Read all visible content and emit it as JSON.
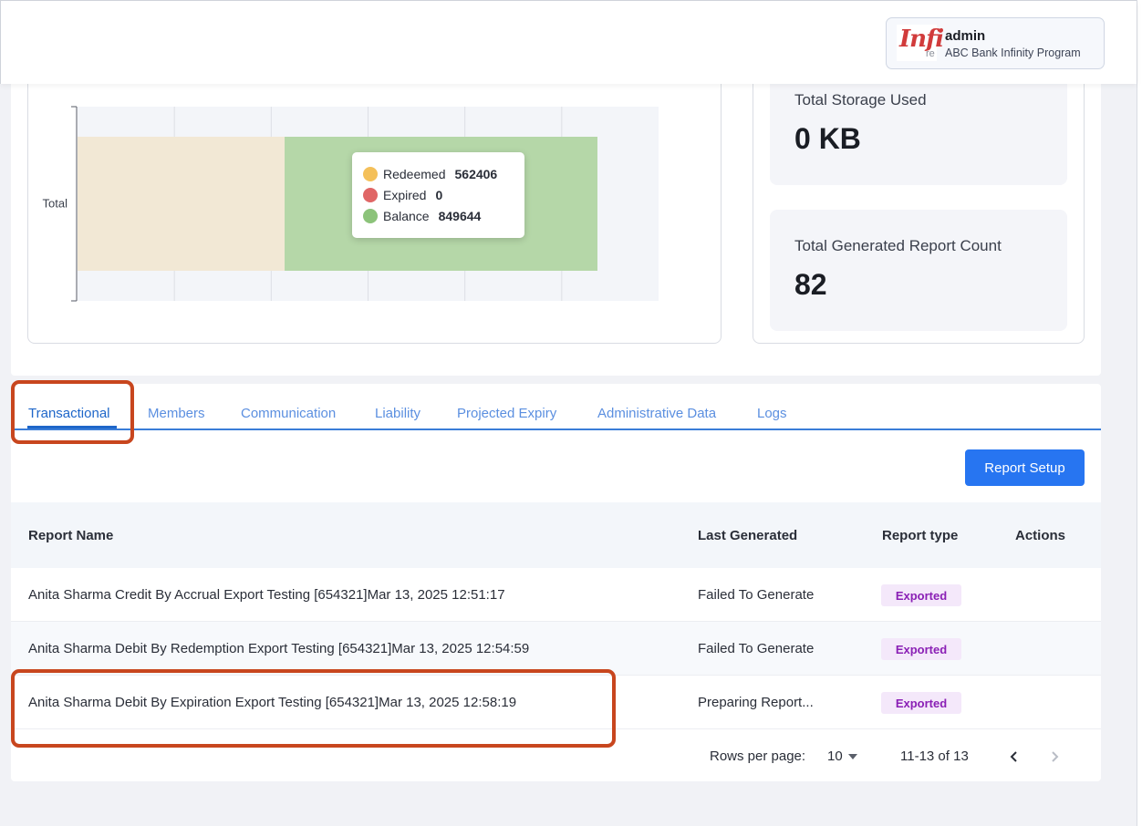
{
  "header": {
    "logo_text": "Infi",
    "logo_sub": "re",
    "user_name": "admin",
    "user_org": "ABC Bank Infinity Program"
  },
  "chart_data": {
    "type": "bar",
    "orientation": "horizontal",
    "stacked": true,
    "categories": [
      "Total"
    ],
    "series": [
      {
        "name": "Redeemed",
        "values": [
          562406
        ],
        "color": "#f2e8d5"
      },
      {
        "name": "Expired",
        "values": [
          0
        ],
        "color": "#e06666"
      },
      {
        "name": "Balance",
        "values": [
          849644
        ],
        "color": "#b5d7a8"
      }
    ],
    "grid": true,
    "legend_position": "tooltip",
    "tooltip": {
      "items": [
        {
          "label": "Redeemed",
          "value": "562406",
          "color": "#f4c05a"
        },
        {
          "label": "Expired",
          "value": "0",
          "color": "#e06666"
        },
        {
          "label": "Balance",
          "value": "849644",
          "color": "#8cc37a"
        }
      ]
    }
  },
  "stats": {
    "storage": {
      "label": "Total Storage Used",
      "value": "0 KB"
    },
    "report_count": {
      "label": "Total Generated Report Count",
      "value": "82"
    }
  },
  "tabs": [
    {
      "label": "Transactional",
      "active": true
    },
    {
      "label": "Members",
      "active": false
    },
    {
      "label": "Communication",
      "active": false
    },
    {
      "label": "Liability",
      "active": false
    },
    {
      "label": "Projected Expiry",
      "active": false
    },
    {
      "label": "Administrative Data",
      "active": false
    },
    {
      "label": "Logs",
      "active": false
    }
  ],
  "report_setup_label": "Report Setup",
  "table": {
    "columns": [
      "Report Name",
      "Last Generated",
      "Report type",
      "Actions"
    ],
    "rows": [
      {
        "name": "Anita Sharma Credit By Accrual Export Testing [654321]Mar 13, 2025 12:51:17",
        "last_generated": "Failed To Generate",
        "type": "Exported"
      },
      {
        "name": "Anita Sharma Debit By Redemption Export Testing [654321]Mar 13, 2025 12:54:59",
        "last_generated": "Failed To Generate",
        "type": "Exported"
      },
      {
        "name": "Anita Sharma Debit By Expiration Export Testing [654321]Mar 13, 2025 12:58:19",
        "last_generated": "Preparing Report...",
        "type": "Exported"
      }
    ]
  },
  "pagination": {
    "rows_per_page_label": "Rows per page:",
    "rows_per_page_value": "10",
    "range": "11-13 of 13",
    "prev_icon": "chevron-left-icon",
    "next_icon": "chevron-right-icon"
  },
  "colors": {
    "accent": "#2775f1",
    "tab_active": "#1e66c9",
    "badge_text": "#8a1fb5",
    "badge_bg": "#f4e8fa",
    "highlight": "#c8461e"
  }
}
